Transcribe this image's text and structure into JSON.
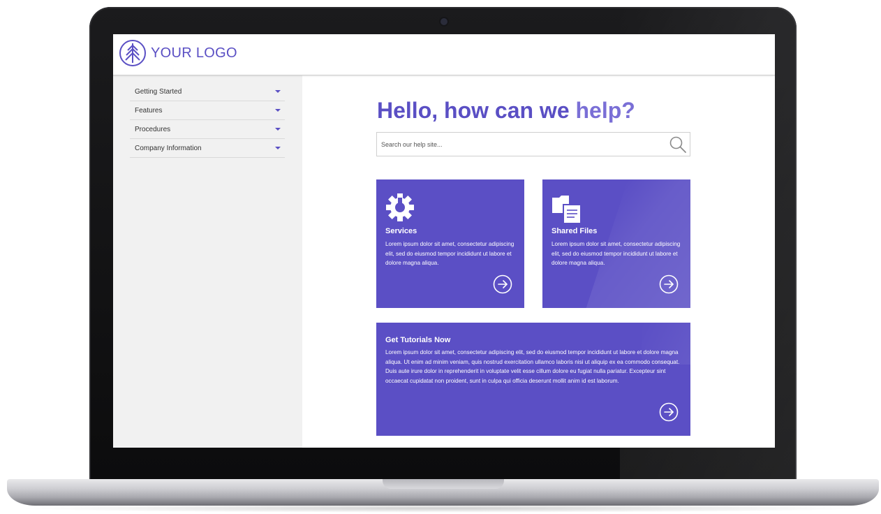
{
  "header": {
    "logo_text": "YOUR LOGO",
    "logo_icon": "tree-in-circle-icon"
  },
  "sidebar": {
    "items": [
      {
        "label": "Getting Started"
      },
      {
        "label": "Features"
      },
      {
        "label": "Procedures"
      },
      {
        "label": "Company Information"
      }
    ]
  },
  "main": {
    "heading_main": "Hello, how can we ",
    "heading_accent": "help?",
    "search": {
      "placeholder": "Search our help site..."
    },
    "cards": [
      {
        "title": "Services",
        "icon": "gear-icon",
        "body": "Lorem ipsum dolor sit amet, consectetur adipiscing elit, sed do eiusmod tempor incididunt ut labore et dolore magna aliqua."
      },
      {
        "title": "Shared Files",
        "icon": "files-icon",
        "body": "Lorem ipsum dolor sit amet, consectetur adipiscing elit, sed do eiusmod tempor incididunt ut labore et dolore magna aliqua."
      },
      {
        "title": "Get Tutorials Now",
        "body": "Lorem ipsum dolor sit amet, consectetur adipiscing elit, sed do eiusmod tempor incididunt ut labore et dolore magna aliqua. Ut enim ad minim veniam, quis nostrud exercitation ullamco laboris nisi ut aliquip ex ea commodo consequat. Duis aute irure dolor in reprehenderit in voluptate velit esse cillum dolore eu fugiat nulla pariatur. Excepteur sint occaecat cupidatat non proident, sunt in culpa qui officia deserunt mollit anim id est laborum."
      }
    ]
  },
  "colors": {
    "brand": "#5a4fc4",
    "card": "#5b4fc5",
    "sidebar_bg": "#f1f1f1"
  }
}
